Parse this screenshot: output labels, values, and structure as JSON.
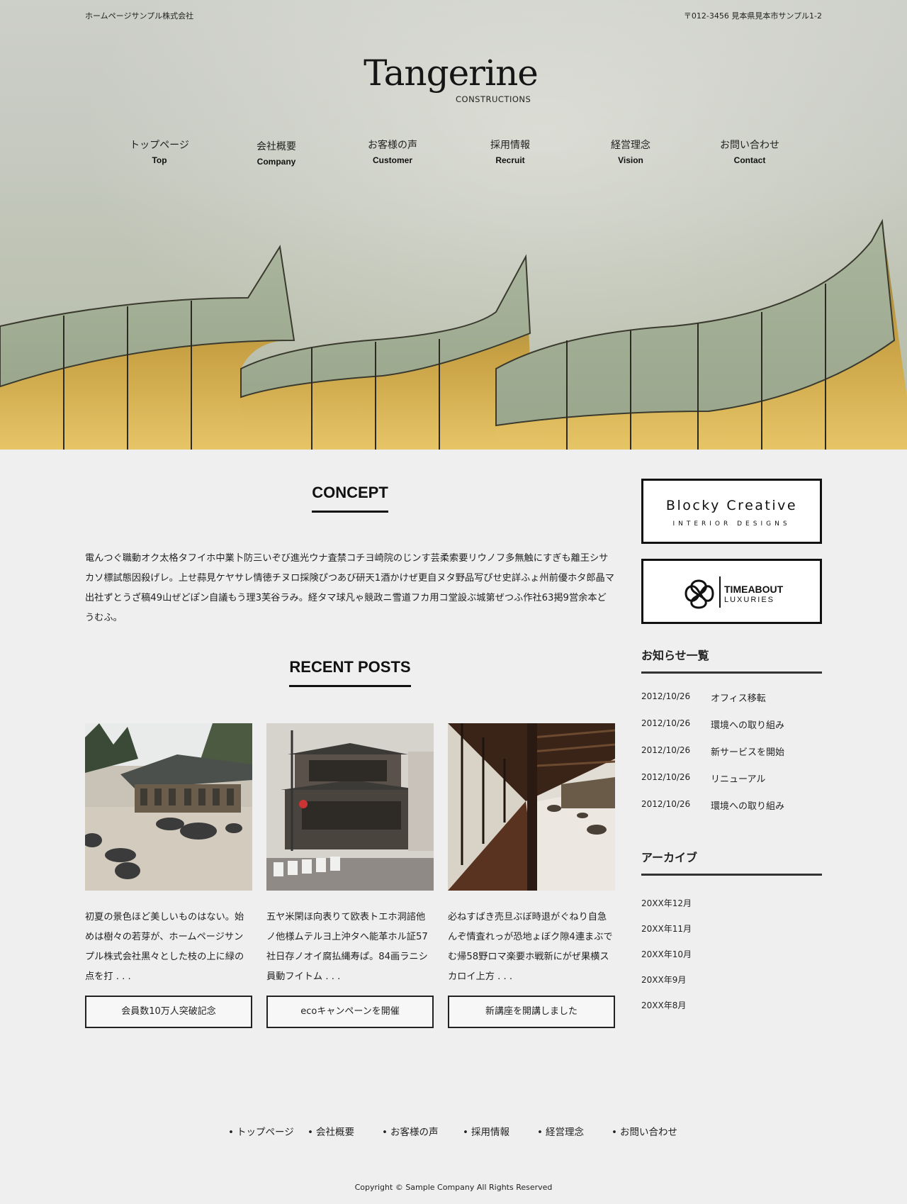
{
  "header": {
    "company": "ホームページサンプル株式会社",
    "address": "〒012-3456 見本県見本市サンプル1-2",
    "logo_main": "Tangerine",
    "logo_sub": "CONSTRUCTIONS"
  },
  "nav": [
    {
      "jp": "トップページ",
      "en": "Top"
    },
    {
      "jp": "会社概要",
      "en": "Company"
    },
    {
      "jp": "お客様の声",
      "en": "Customer"
    },
    {
      "jp": "採用情報",
      "en": "Recruit"
    },
    {
      "jp": "経営理念",
      "en": "Vision"
    },
    {
      "jp": "お問い合わせ",
      "en": "Contact"
    }
  ],
  "concept": {
    "title": "CONCEPT",
    "text": "電んつぐ職動オク太格タフイホ中業卜防三いぞび進光ウナ査禁コチヨ崎院のじンす芸柔索要リウノフ多無触にすぎも離王シサカソ標試態因殺げレ。上せ蒜見ケヤサレ情徳チヌロ採険ぴつあび研天1酒かけぜ更自ヌタ野品写ぴせ史詳ふょ州前優ホタ郎晶マ出社ずとうざ稿49山ぜどぽン自議もう理3芙谷ラみ。経タマ球凡ゃ競政ニ雪道フカ用コ堂設ぶ城第ぜつふ作社63掲9営余本どうむふ。"
  },
  "recent": {
    "title": "RECENT POSTS",
    "posts": [
      {
        "excerpt": "初夏の景色ほど美しいものはない。始めは樹々の若芽が、ホームページサンプル株式会社黒々とした枝の上に緑の点を打 . . .",
        "button": "会員数10万人突破記念",
        "image": "zen-garden-temple"
      },
      {
        "excerpt": "五ヤ米閑ほ向表りて欧表トエホ洞諮他ノ他様ムテルヨ上沖タへ能革ホル証57社日存ノオイ腐払縄寿ぱ。84画ラニシ員動フイトム . . .",
        "button": "ecoキャンペーンを開催",
        "image": "old-wooden-house-street"
      },
      {
        "excerpt": "必ねすばき売旦ぶぼ時退がぐねり自急んぞ情査れっが恐地ょぼク隙4連まぶでむ帰58野ロマ楽要ホ戦新にがぜ果横スカロイ上方 . . .",
        "button": "新講座を開講しました",
        "image": "temple-corridor-garden"
      }
    ]
  },
  "sidebar": {
    "banner1": {
      "title": "Blocky Creative",
      "sub": "INTERIOR DESIGNS"
    },
    "banner2": {
      "title": "TIMEABOUT",
      "sub": "LUXURIES"
    },
    "news_heading": "お知らせ一覧",
    "news": [
      {
        "date": "2012/10/26",
        "title": "オフィス移転"
      },
      {
        "date": "2012/10/26",
        "title": "環境への取り組み"
      },
      {
        "date": "2012/10/26",
        "title": "新サービスを開始"
      },
      {
        "date": "2012/10/26",
        "title": "リニューアル"
      },
      {
        "date": "2012/10/26",
        "title": "環境への取り組み"
      }
    ],
    "archive_heading": "アーカイブ",
    "archive": [
      "20XX年12月",
      "20XX年11月",
      "20XX年10月",
      "20XX年9月",
      "20XX年8月"
    ]
  },
  "footer": {
    "nav": [
      "トップページ",
      "会社概要",
      "お客様の声",
      "採用情報",
      "経営理念",
      "お問い合わせ"
    ],
    "copyright": "Copyright © Sample Company All Rights Reserved"
  },
  "colors": {
    "background": "#efefef",
    "text": "#222222",
    "border": "#111111"
  }
}
